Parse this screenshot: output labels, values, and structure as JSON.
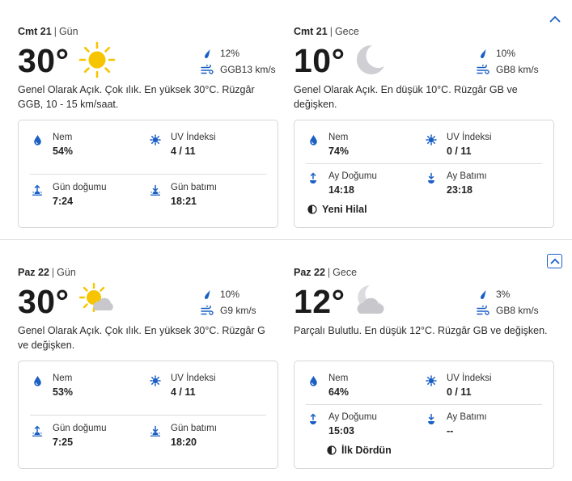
{
  "colors": {
    "accent": "#1a5fc4",
    "sun": "#f6c500",
    "moon": "#cfcfd4",
    "cloud": "#c8c8cc",
    "divider": "#dcdcdc"
  },
  "days": [
    {
      "collapse_icon": "chevron-up-icon",
      "day": {
        "date": "Cmt 21",
        "period": "Gün",
        "temp": "30°",
        "icon": "sun-icon",
        "precip": "12%",
        "wind": "GGB13 km/s",
        "narrative": "Genel Olarak Açık. Çok ılık. En yüksek 30°C. Rüzgâr GGB, 10 - 15 km/saat.",
        "details": {
          "humidity_label": "Nem",
          "humidity": "54%",
          "uv_label": "UV İndeksi",
          "uv": "4 / 11",
          "rise_label": "Gün doğumu",
          "rise": "7:24",
          "set_label": "Gün batımı",
          "set": "18:21"
        }
      },
      "night": {
        "date": "Cmt 21",
        "period": "Gece",
        "temp": "10°",
        "icon": "moon-icon",
        "precip": "10%",
        "wind": "GB8 km/s",
        "narrative": "Genel Olarak Açık. En düşük 10°C. Rüzgâr GB ve değişken.",
        "details": {
          "humidity_label": "Nem",
          "humidity": "74%",
          "uv_label": "UV İndeksi",
          "uv": "0 / 11",
          "rise_label": "Ay Doğumu",
          "rise": "14:18",
          "set_label": "Ay Batımı",
          "set": "23:18",
          "moon_phase": "Yeni Hilal"
        }
      }
    },
    {
      "collapse_icon": "chevron-up-icon",
      "day": {
        "date": "Paz 22",
        "period": "Gün",
        "temp": "30°",
        "icon": "partly-sunny-icon",
        "precip": "10%",
        "wind": "G9 km/s",
        "narrative": "Genel Olarak Açık. Çok ılık. En yüksek 30°C. Rüzgâr G ve değişken.",
        "details": {
          "humidity_label": "Nem",
          "humidity": "53%",
          "uv_label": "UV İndeksi",
          "uv": "4 / 11",
          "rise_label": "Gün doğumu",
          "rise": "7:25",
          "set_label": "Gün batımı",
          "set": "18:20"
        }
      },
      "night": {
        "date": "Paz 22",
        "period": "Gece",
        "temp": "12°",
        "icon": "partly-cloudy-night-icon",
        "precip": "3%",
        "wind": "GB8 km/s",
        "narrative": "Parçalı Bulutlu. En düşük 12°C. Rüzgâr GB ve değişken.",
        "details": {
          "humidity_label": "Nem",
          "humidity": "64%",
          "uv_label": "UV İndeksi",
          "uv": "0 / 11",
          "rise_label": "Ay Doğumu",
          "rise": "15:03",
          "set_label": "Ay Batımı",
          "set": "--",
          "moon_phase": "İlk Dördün"
        }
      }
    }
  ]
}
